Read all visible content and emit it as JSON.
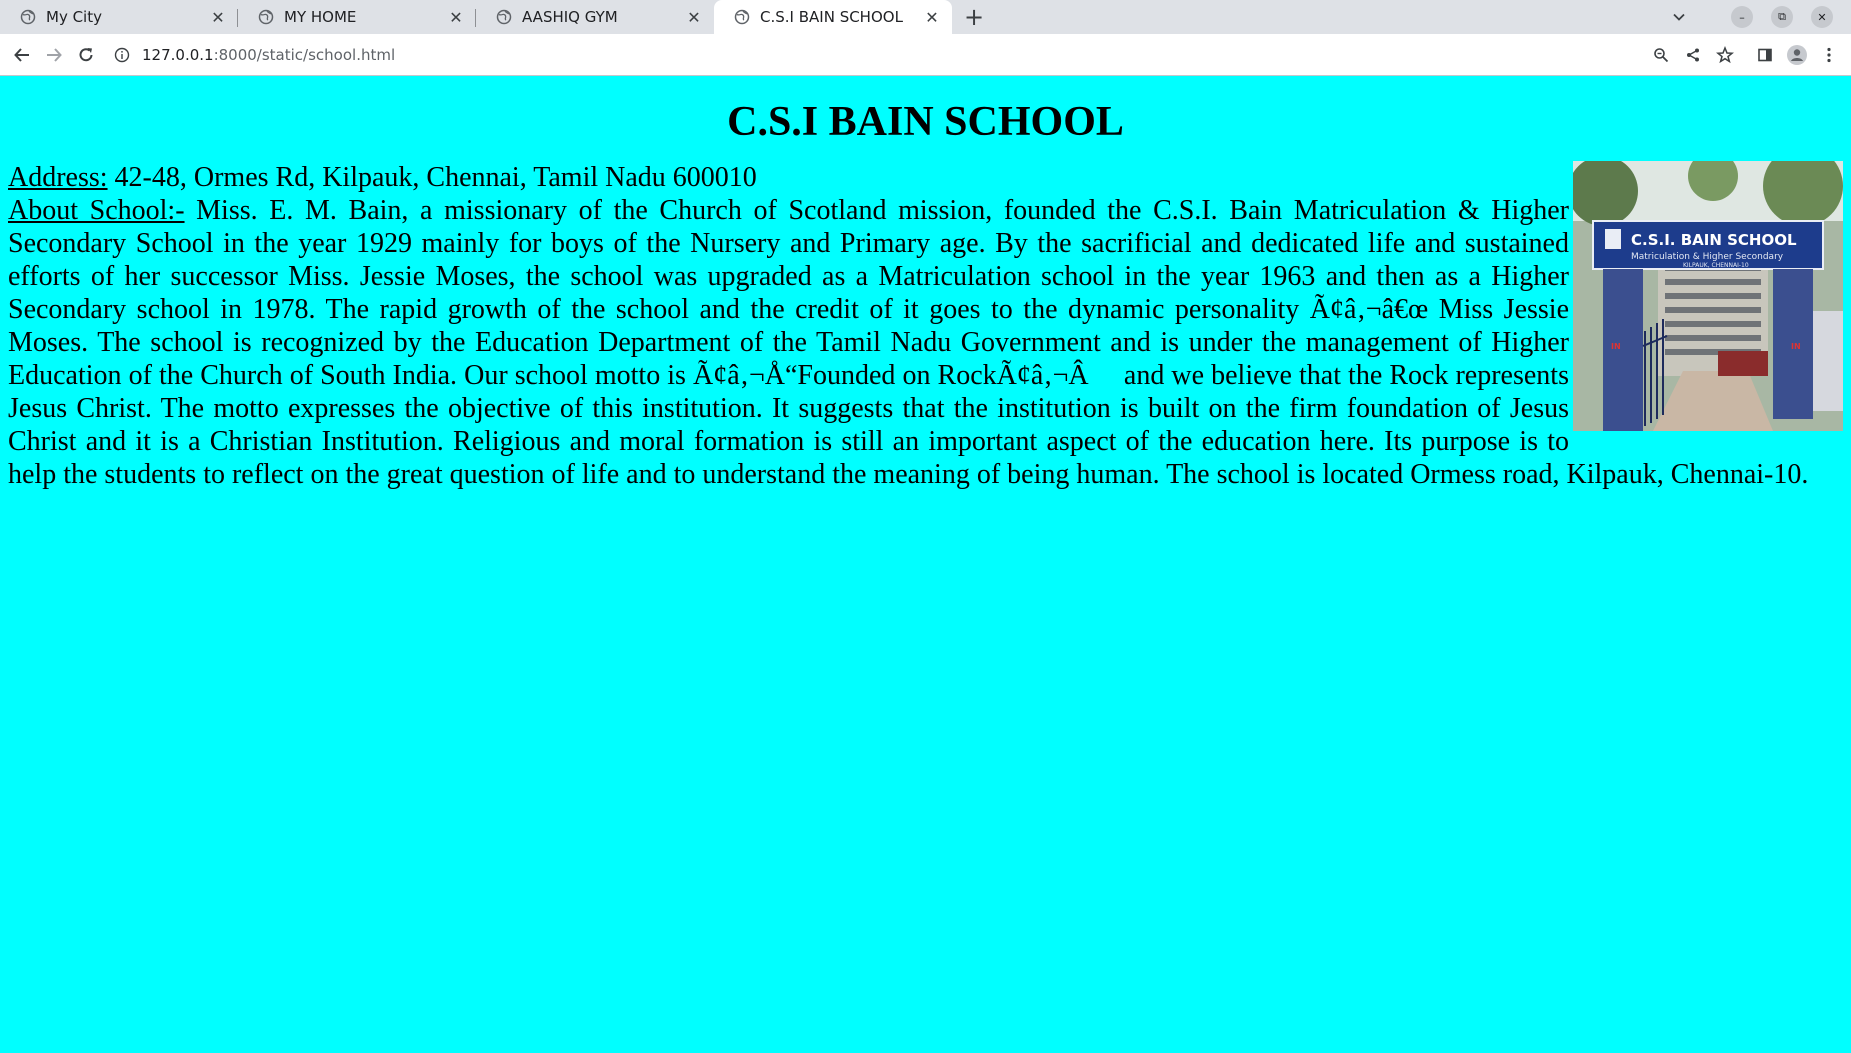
{
  "browser": {
    "tabs": [
      {
        "title": "My City",
        "active": false
      },
      {
        "title": "MY HOME",
        "active": false
      },
      {
        "title": "AASHIQ GYM",
        "active": false
      },
      {
        "title": "C.S.I BAIN SCHOOL",
        "active": true
      }
    ],
    "url_host": "127.0.0.1",
    "url_path": ":8000/static/school.html"
  },
  "page": {
    "title": "C.S.I BAIN SCHOOL",
    "address_label": "Address:",
    "address": " 42-48, Ormes Rd, Kilpauk, Chennai, Tamil Nadu 600010",
    "about_label": "About School:-",
    "about_text": " Miss. E. M. Bain, a missionary of the Church of Scotland mission, founded the C.S.I. Bain Matriculation & Higher Secondary School in the year 1929 mainly for boys of the Nursery and Primary age. By the sacrificial and dedicated life and sustained efforts of her successor Miss. Jessie Moses, the school was upgraded as a Matriculation school in the year 1963 and then as a Higher Secondary school in 1978. The rapid growth of the school and the credit of it goes to the dynamic personality Ã¢â‚¬â€œ Miss Jessie Moses. The school is recognized by the Education Department of the Tamil Nadu Government and is under the management of Higher Education of the Church of South India. Our school motto is Ã¢â‚¬Å“Founded on RockÃ¢â‚¬Â     and we believe that the Rock represents Jesus Christ. The motto expresses the objective of this institution. It suggests that the institution is built on the firm foundation of Jesus Christ and it is a Christian Institution. Religious and moral formation is still an important aspect of the education here. Its purpose is to help the students to reflect on the great question of life and to understand the meaning of being human. The school is located Ormess road, Kilpauk, Chennai-10.",
    "photo": {
      "sign_line1": "C.S.I. BAIN SCHOOL",
      "sign_line2": "Matriculation & Higher Secondary",
      "sign_line3": "KILPAUK, CHENNAI-10",
      "gate_mark": "IN"
    }
  },
  "colors": {
    "page_bg": "#00ffff",
    "tabbar_bg": "#dee1e6",
    "toolbar_bg": "#ffffff"
  }
}
